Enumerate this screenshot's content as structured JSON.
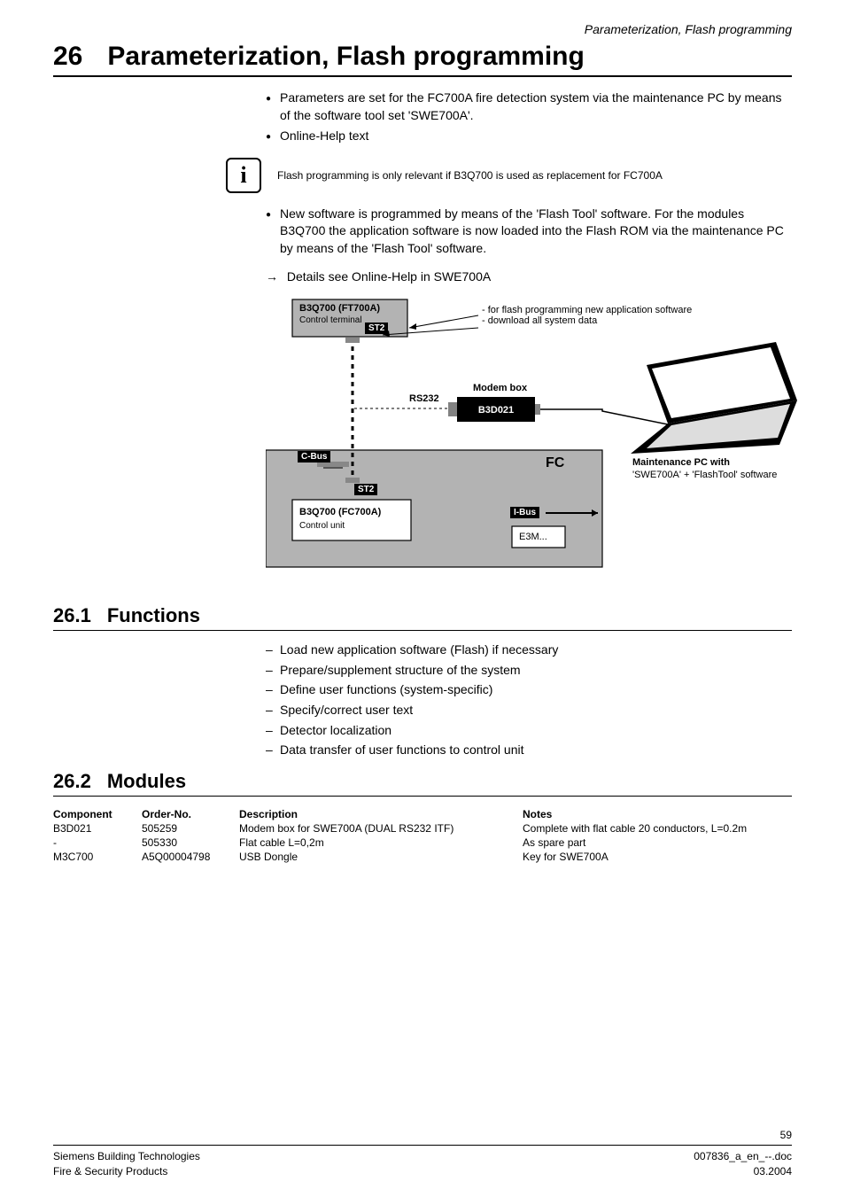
{
  "running_header": "Parameterization, Flash programming",
  "h1": {
    "num": "26",
    "title": "Parameterization, Flash programming"
  },
  "intro_bullets": {
    "b1": "Parameters are set for the FC700A fire detection system via the maintenance PC by means of the software tool set 'SWE700A'.",
    "b2": "Online-Help text"
  },
  "info_note": "Flash programming is only relevant if B3Q700 is used as replacement for FC700A",
  "after_info_bullet": "New software is programmed by means of the 'Flash Tool' software. For the modules B3Q700 the application software is now loaded into the Flash ROM via the maintenance PC by means of the 'Flash Tool' software.",
  "arrow_line": "Details see Online-Help in SWE700A",
  "diagram": {
    "top_box_title": "B3Q700 (FT700A)",
    "top_box_sub": "Control terminal",
    "st2": "ST2",
    "cbus": "C-Bus",
    "rs232": "RS232",
    "modem_title": "Modem box",
    "modem_code": "B3D021",
    "fc": "FC",
    "ibus": "I-Bus",
    "bottom_title": "B3Q700 (FC700A)",
    "bottom_sub": "Control unit",
    "e3m": "E3M...",
    "top_note": "- for flash programming new application software\n- download all system data",
    "pc_line1": "Maintenance PC with",
    "pc_line2": "'SWE700A' + 'FlashTool' software"
  },
  "h2_1": {
    "num": "26.1",
    "title": "Functions"
  },
  "functions": {
    "f1": "Load new application software (Flash) if necessary",
    "f2": "Prepare/supplement structure of the system",
    "f3": "Define user functions (system-specific)",
    "f4": "Specify/correct user text",
    "f5": "Detector localization",
    "f6": "Data transfer of user functions to control unit"
  },
  "h2_2": {
    "num": "26.2",
    "title": "Modules"
  },
  "table": {
    "headers": {
      "c1": "Component",
      "c2": "Order-No.",
      "c3": "Description",
      "c4": "Notes"
    },
    "rows": [
      {
        "c1": "B3D021",
        "c2": "505259",
        "c3": "Modem box for SWE700A (DUAL RS232 ITF)",
        "c4": "Complete with flat cable 20 conductors, L=0.2m"
      },
      {
        "c1": "-",
        "c2": "505330",
        "c3": "Flat cable L=0,2m",
        "c4": "As spare part"
      },
      {
        "c1": "M3C700",
        "c2": "A5Q00004798",
        "c3": "USB Dongle",
        "c4": "Key for SWE700A"
      }
    ]
  },
  "footer": {
    "page": "59",
    "left1": "Siemens Building Technologies",
    "left2": "Fire & Security Products",
    "right1": "007836_a_en_--.doc",
    "right2": "03.2004"
  }
}
